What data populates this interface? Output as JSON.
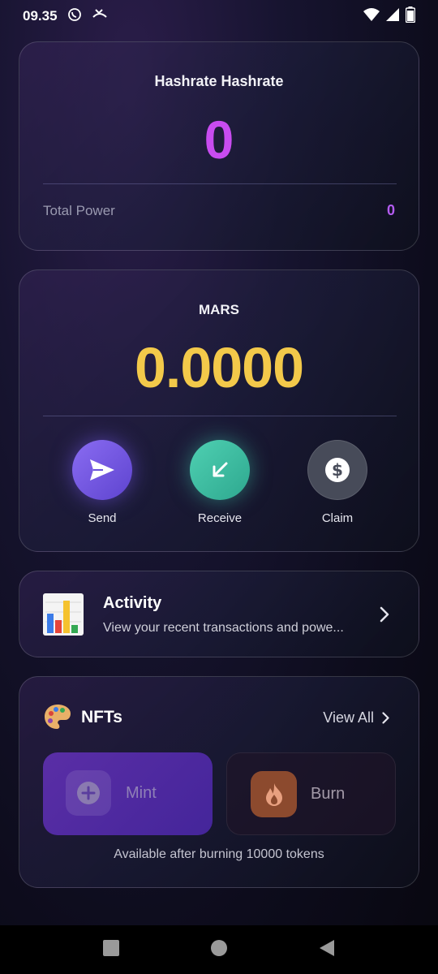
{
  "status_bar": {
    "time": "09.35",
    "icons": [
      "whatsapp-icon",
      "missed-call-icon",
      "wifi-icon",
      "signal-icon",
      "battery-icon"
    ]
  },
  "hashrate_card": {
    "title": "Hashrate Hashrate",
    "value": "0",
    "total_power_label": "Total Power",
    "total_power_value": "0",
    "value_color": "#c84cf0"
  },
  "mars_card": {
    "title": "MARS",
    "balance": "0.0000",
    "balance_color": "#f3c94a",
    "actions": [
      {
        "label": "Send",
        "icon": "send-icon",
        "color": "#7b5be6"
      },
      {
        "label": "Receive",
        "icon": "arrow-down-left-icon",
        "color": "#3fbfa4"
      },
      {
        "label": "Claim",
        "icon": "dollar-icon",
        "color": "#4a4e5c"
      }
    ]
  },
  "activity_card": {
    "icon": "bar-chart-icon",
    "title": "Activity",
    "subtitle": "View your recent transactions and powe..."
  },
  "nfts_card": {
    "icon": "palette-icon",
    "title": "NFTs",
    "view_all": "View All",
    "mint_label": "Mint",
    "burn_label": "Burn",
    "note": "Available after burning 10000 tokens"
  },
  "nav_bar": {
    "buttons": [
      "recents-icon",
      "home-icon",
      "back-icon"
    ]
  }
}
